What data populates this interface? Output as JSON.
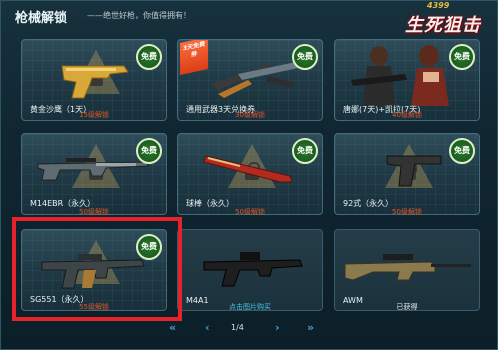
{
  "header": {
    "title": "枪械解锁",
    "subtitle": "——绝世好枪，你值得拥有！"
  },
  "logo": {
    "number": "4399",
    "name": "生死狙击"
  },
  "badge_label": "免费",
  "cards": [
    {
      "label": "黄金沙鹰（1天）",
      "requirement": "15级解锁",
      "badge": true
    },
    {
      "label": "通用武器3天兑换券",
      "requirement": "30级解锁",
      "badge": true,
      "ribbon": "3天免费券"
    },
    {
      "label": "唐娜(7天)+凯拉(7天)",
      "requirement": "40级解锁",
      "badge": true
    },
    {
      "label": "M14EBR（永久）",
      "requirement": "50级解锁",
      "badge": true
    },
    {
      "label": "球棒（永久）",
      "requirement": "50级解锁",
      "badge": true
    },
    {
      "label": "92式（永久）",
      "requirement": "50级解锁",
      "badge": true
    },
    {
      "label": "SG551（永久）",
      "requirement": "55级解锁",
      "badge": true
    },
    {
      "label": "M4A1",
      "status": "点击图片购买",
      "status_color": "#4bc3e6",
      "badge": false
    },
    {
      "label": "AWM",
      "status": "已获得",
      "status_color": "#e7eff2",
      "badge": false
    }
  ],
  "pager": {
    "first": "«",
    "prev": "‹",
    "page": "1/4",
    "next": "›",
    "last": "»"
  }
}
